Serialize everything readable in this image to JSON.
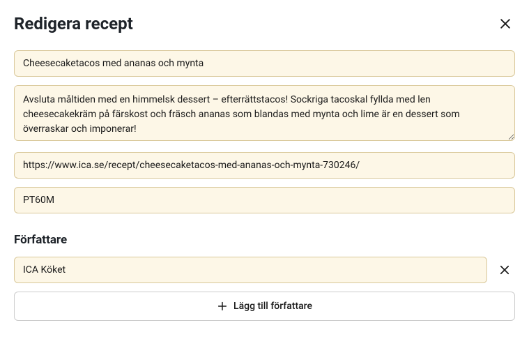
{
  "header": {
    "title": "Redigera recept"
  },
  "fields": {
    "name": "Cheesecaketacos med ananas och mynta",
    "description": "Avsluta måltiden med en himmelsk dessert – efterrättstacos! Sockriga tacoskal fyllda med len cheesecakekräm på färskost och fräsch ananas som blandas med mynta och lime är en dessert som överraskar och imponerar!",
    "url": "https://www.ica.se/recept/cheesecaketacos-med-ananas-och-mynta-730246/",
    "duration": "PT60M"
  },
  "authorsSection": {
    "label": "Författare",
    "items": [
      {
        "name": "ICA Köket"
      }
    ],
    "addLabel": "Lägg till författare"
  }
}
